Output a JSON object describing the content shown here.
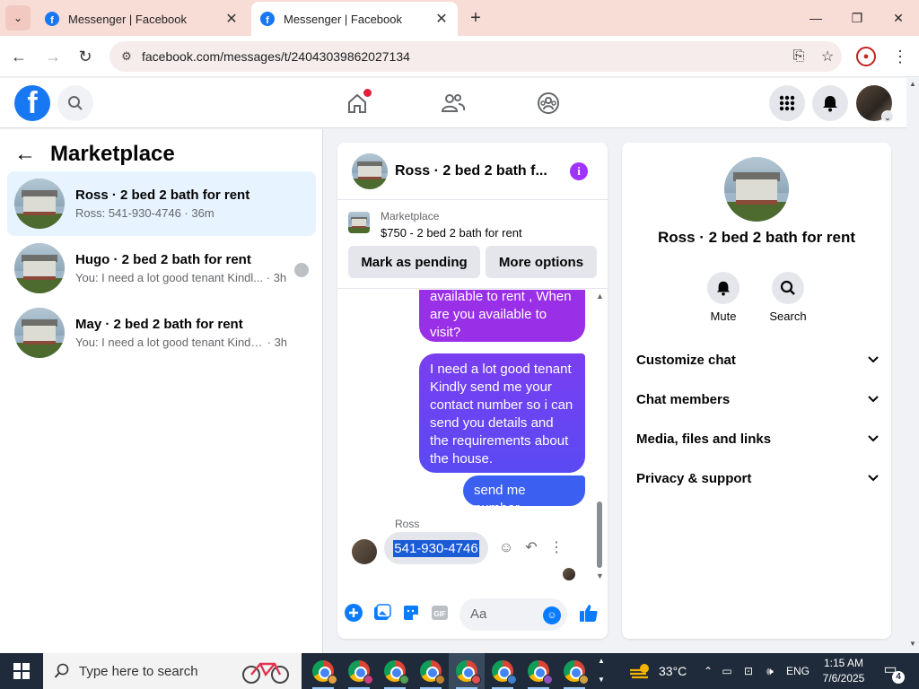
{
  "browser": {
    "tabs": [
      {
        "title": "Messenger | Facebook"
      },
      {
        "title": "Messenger | Facebook"
      }
    ],
    "url": "facebook.com/messages/t/24043039862027134"
  },
  "fb_header": {
    "icons": [
      "facebook-logo",
      "search-icon",
      "home-icon",
      "friends-icon",
      "groups-icon",
      "menu-grid-icon",
      "bell-icon",
      "account-avatar"
    ]
  },
  "sidebar": {
    "title": "Marketplace",
    "conversations": [
      {
        "name": "Ross · 2 bed 2 bath for rent",
        "preview": "Ross: 541-930-4746",
        "time": "36m",
        "active": true
      },
      {
        "name": "Hugo · 2 bed 2 bath for rent",
        "preview": "You: I need a lot good tenant Kindl...",
        "time": "3h",
        "active": false
      },
      {
        "name": "May · 2 bed 2 bath for rent",
        "preview": "You: I need a lot good tenant Kindly s...",
        "time": "3h",
        "active": false
      }
    ]
  },
  "chat": {
    "title": "Ross · 2 bed 2 bath f...",
    "marketplace": {
      "label": "Marketplace",
      "listing": "$750 - 2 bed 2 bath for rent",
      "mark_pending": "Mark as pending",
      "more_options": "More options"
    },
    "messages": [
      {
        "text": "available to rent , When are you available to visit?",
        "from": "me"
      },
      {
        "text": "I need a lot good tenant Kindly send me your contact number so i can send you details and the requirements about the house.",
        "from": "me"
      },
      {
        "text": "send me number",
        "from": "me"
      },
      {
        "sender": "Ross",
        "text": "541-930-4746",
        "from": "them"
      }
    ],
    "composer_placeholder": "Aa",
    "accent_color": "#0a7cff"
  },
  "info_panel": {
    "name": "Ross · 2 bed 2 bath for rent",
    "actions": [
      {
        "label": "Mute"
      },
      {
        "label": "Search"
      }
    ],
    "sections": [
      {
        "label": "Customize chat"
      },
      {
        "label": "Chat members"
      },
      {
        "label": "Media, files and links"
      },
      {
        "label": "Privacy & support"
      }
    ]
  },
  "taskbar": {
    "search_placeholder": "Type here to search",
    "weather": "33°C",
    "language": "ENG",
    "time": "1:15 AM",
    "date": "7/6/2025",
    "notification_count": "4"
  }
}
